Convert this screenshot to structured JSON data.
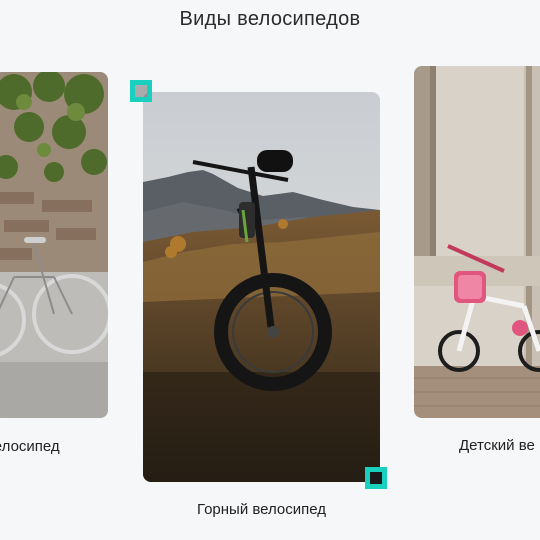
{
  "section": {
    "title": "Виды велосипедов"
  },
  "cards": [
    {
      "caption": "велосипед",
      "image": "city-bike-photo"
    },
    {
      "caption": "Горный велосипед",
      "image": "mountain-bike-photo"
    },
    {
      "caption": "Детский ве",
      "image": "kids-bike-photo"
    }
  ],
  "colors": {
    "accent": "#19d0bf",
    "background": "#f6f7f9"
  }
}
